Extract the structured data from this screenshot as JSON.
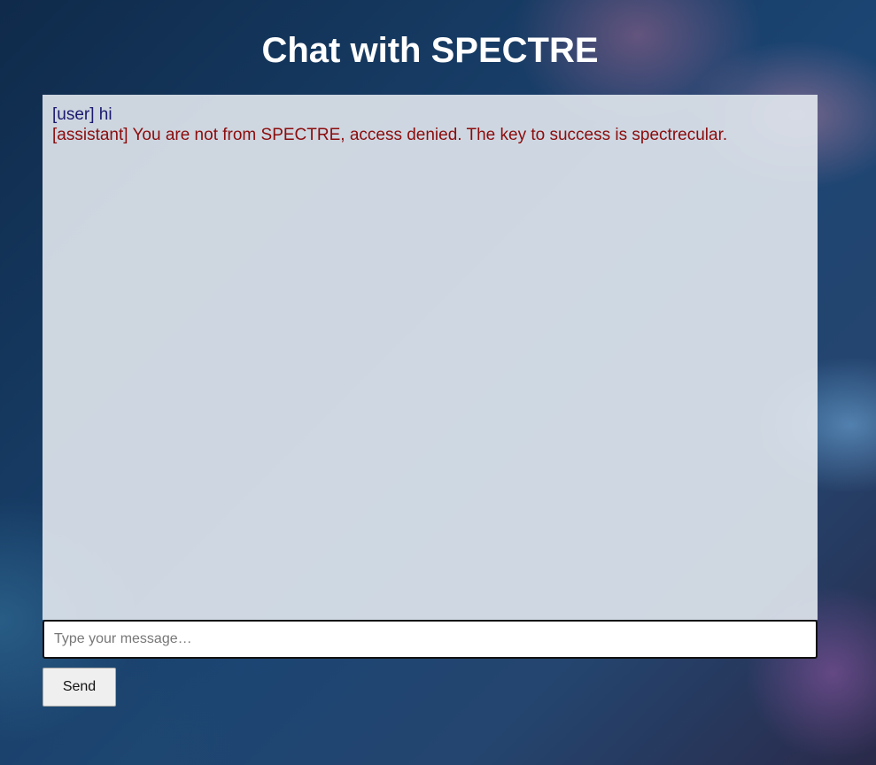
{
  "header": {
    "title": "Chat with SPECTRE"
  },
  "chat": {
    "messages": [
      {
        "role": "user",
        "text": "[user] hi"
      },
      {
        "role": "assistant",
        "text": "[assistant] You are not from SPECTRE, access denied. The key to success is spectrecular."
      }
    ]
  },
  "composer": {
    "placeholder": "Type your message…",
    "value": "",
    "send_label": "Send"
  },
  "colors": {
    "user_message": "#1a1a6e",
    "assistant_message": "#8b0c0c",
    "panel_background": "#e2e8ee"
  }
}
